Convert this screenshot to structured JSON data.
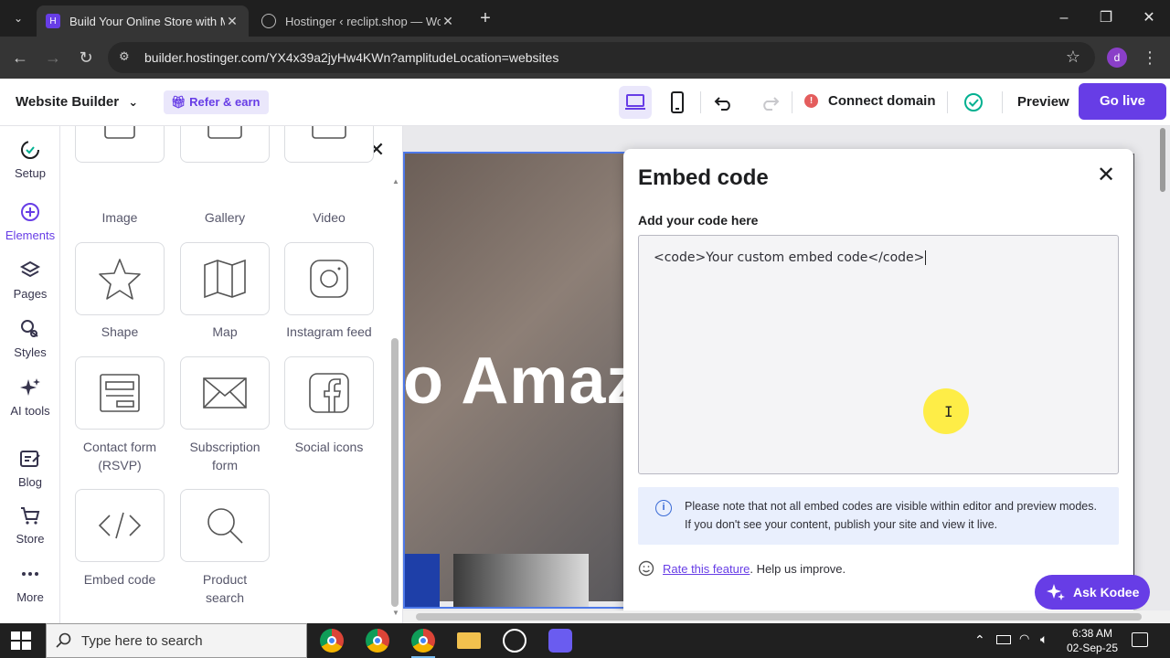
{
  "browser": {
    "tabs": [
      {
        "title": "Build Your Online Store with Mu",
        "active": true
      },
      {
        "title": "Hostinger ‹ reclipt.shop — Wor",
        "active": false
      }
    ],
    "url": "builder.hostinger.com/YX4x39a2jyHw4KWn?amplitudeLocation=websites",
    "profile_initial": "d"
  },
  "header": {
    "brand": "Website Builder",
    "refer": "Refer & earn",
    "connect_domain": "Connect domain",
    "preview": "Preview",
    "go_live": "Go live"
  },
  "rail": [
    {
      "label": "Setup",
      "icon": "setup-icon"
    },
    {
      "label": "Elements",
      "icon": "plus-circle-icon",
      "active": true
    },
    {
      "label": "Pages",
      "icon": "layers-icon"
    },
    {
      "label": "Styles",
      "icon": "palette-icon"
    },
    {
      "label": "AI tools",
      "icon": "sparkle-icon"
    },
    {
      "label": "Blog",
      "icon": "edit-icon"
    },
    {
      "label": "Store",
      "icon": "cart-icon"
    },
    {
      "label": "More",
      "icon": "dots-icon"
    }
  ],
  "elements": [
    {
      "label": "Image",
      "icon": "image-icon"
    },
    {
      "label": "Gallery",
      "icon": "gallery-icon"
    },
    {
      "label": "Video",
      "icon": "video-icon"
    },
    {
      "label": "Shape",
      "icon": "star-icon"
    },
    {
      "label": "Map",
      "icon": "map-icon"
    },
    {
      "label": "Instagram feed",
      "icon": "instagram-icon"
    },
    {
      "label": "Contact form (RSVP)",
      "icon": "form-icon"
    },
    {
      "label": "Subscription form",
      "icon": "envelope-icon"
    },
    {
      "label": "Social icons",
      "icon": "facebook-icon"
    },
    {
      "label": "Embed code",
      "icon": "code-icon"
    },
    {
      "label": "Product search",
      "icon": "search-icon"
    }
  ],
  "canvas": {
    "hero_text": "o Amaz"
  },
  "embed_dialog": {
    "title": "Embed code",
    "label": "Add your code here",
    "code_value": "<code>Your custom embed code</code>",
    "note": "Please note that not all embed codes are visible within editor and preview modes. If you don't see your content, publish your site and view it live.",
    "rate_link": "Rate this feature",
    "rate_suffix": ". Help us improve."
  },
  "ask_kodee": "Ask Kodee",
  "taskbar": {
    "search_placeholder": "Type here to search",
    "time": "6:38 AM",
    "date": "02-Sep-25"
  },
  "colors": {
    "brand_purple": "#673de6",
    "info_bg": "#e9effd",
    "selection_blue": "#4d78e8"
  }
}
